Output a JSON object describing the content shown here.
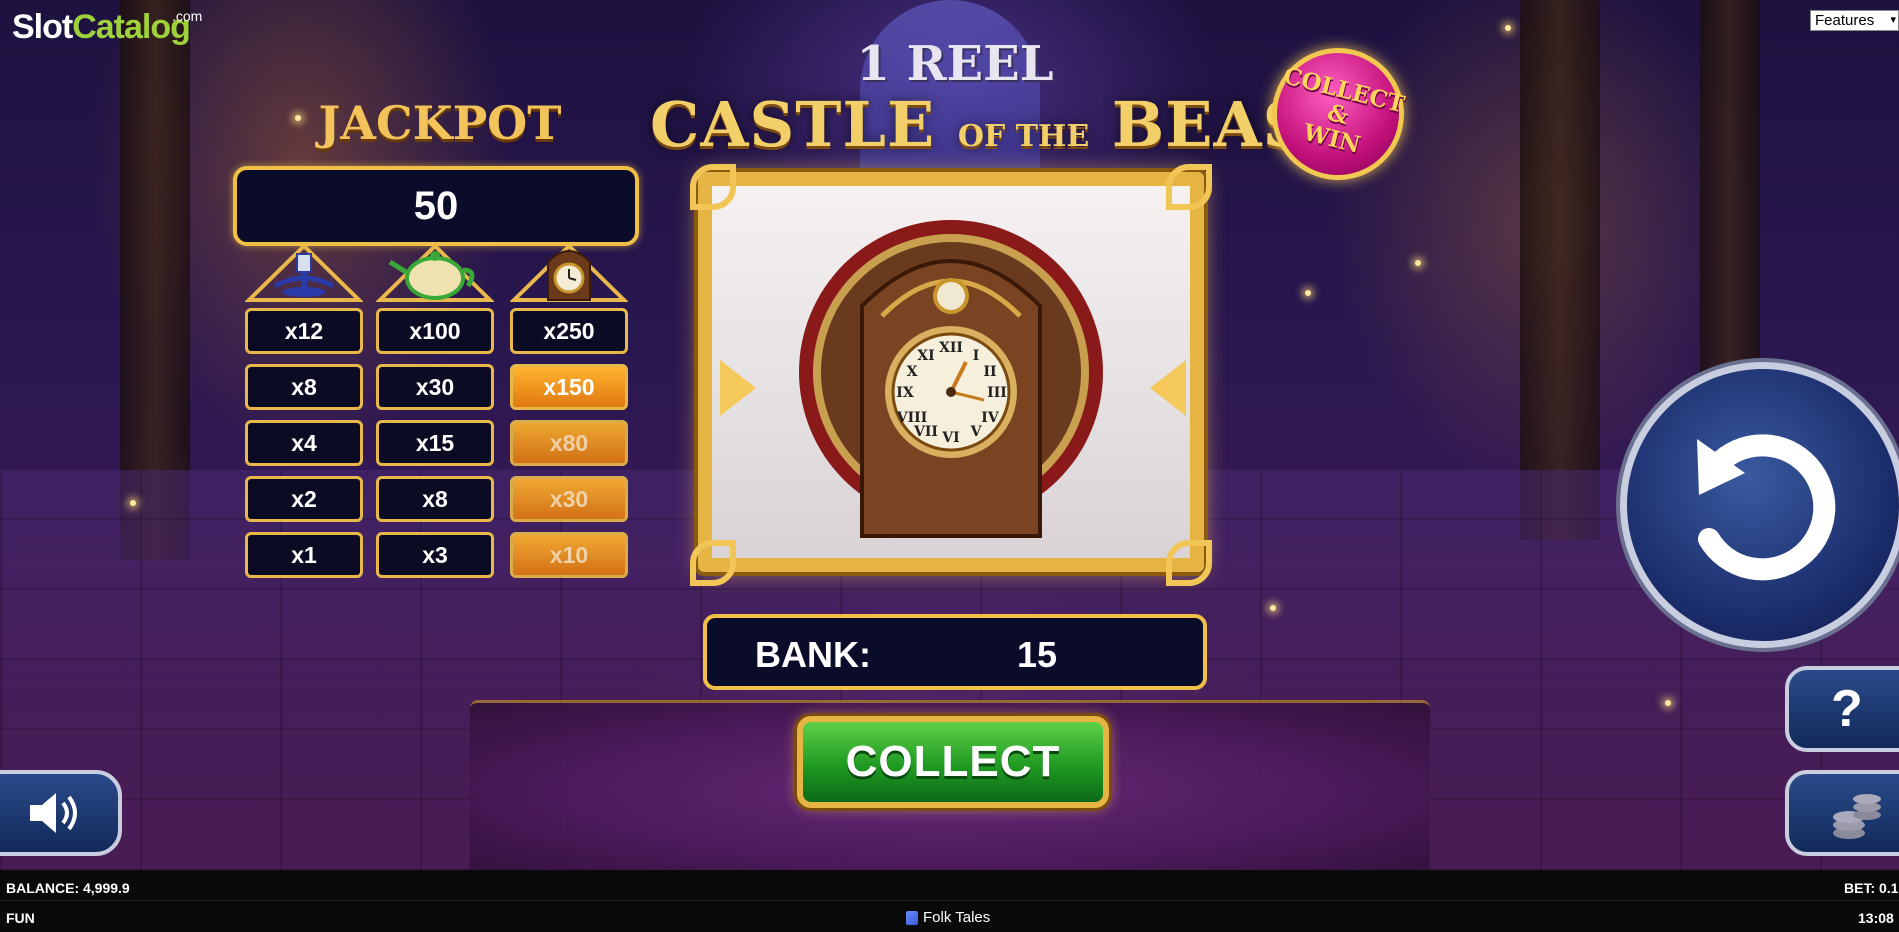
{
  "logo": {
    "main_a": "Slot",
    "main_b": "Catalog",
    "suffix": ".com"
  },
  "features_select": {
    "selected": "Features"
  },
  "title": {
    "line1": "1 REEL",
    "word1": "CASTLE",
    "word_small": "OF THE",
    "word2": "BEAST"
  },
  "badge": {
    "line1": "COLLECT",
    "line2": "&",
    "line3": "WIN"
  },
  "jackpot": {
    "title": "JACKPOT",
    "value": "50",
    "columns": [
      {
        "icon": "candlestick-icon",
        "cells": [
          "x12",
          "x8",
          "x4",
          "x2",
          "x1"
        ]
      },
      {
        "icon": "teapot-icon",
        "cells": [
          "x100",
          "x30",
          "x15",
          "x8",
          "x3"
        ]
      },
      {
        "icon": "clock-icon",
        "cells": [
          "x250",
          "x150",
          "x80",
          "x30",
          "x10"
        ],
        "highlighted_from_row": 1
      }
    ]
  },
  "reel": {
    "symbol": "grandfather-clock-icon"
  },
  "bank": {
    "label": "BANK:",
    "value": "15"
  },
  "collect_button": {
    "label": "COLLECT"
  },
  "help_button": {
    "label": "?"
  },
  "status_bar": {
    "balance": "BALANCE: 4,999.9",
    "bet": "BET: 0.1",
    "mode": "FUN",
    "provider": "Folk Tales",
    "clock": "13:08"
  },
  "colors": {
    "gold": "#f0c046",
    "panel": "#0b0c2a",
    "highlight": "#f39a20",
    "collect_green": "#2aa82a",
    "badge_pink": "#c2107a"
  }
}
